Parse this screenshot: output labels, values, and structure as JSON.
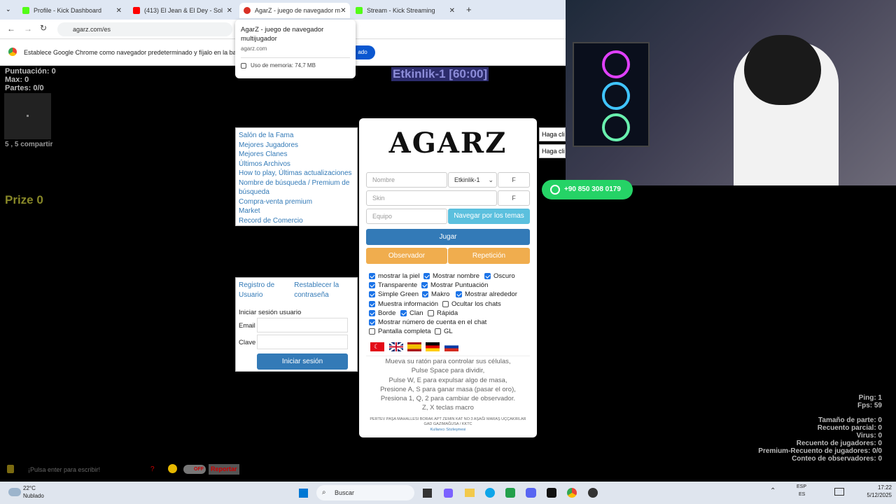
{
  "tabs": [
    {
      "label": "Profile - Kick Dashboard",
      "icon": "kick-icon",
      "color": "#53fc18"
    },
    {
      "label": "(413) El Jean & El Dey - Sol",
      "icon": "youtube-icon",
      "color": "#ff0000"
    },
    {
      "label": "AgarZ - juego de navegador m",
      "icon": "agarz-icon",
      "color": "#d93025"
    },
    {
      "label": "Stream - Kick Streaming",
      "icon": "kick-icon",
      "color": "#53fc18"
    }
  ],
  "address": "agarz.com/es",
  "infobar_text": "Establece Google Chrome como navegador predeterminado y fíjalo en la barra",
  "infobar_button": "ado",
  "tooltip": {
    "title": "AgarZ - juego de navegador multijugador",
    "domain": "agarz.com",
    "memory": "Uso de memoria: 74,7 MB"
  },
  "hud": {
    "score": "Puntuación: 0",
    "max": "Max: 0",
    "parts": "Partes: 0/0",
    "share": "5 , 5 compartir",
    "prize": "Prize 0",
    "event": "Etkinlik-1 [60:00]"
  },
  "menu": [
    "Salón de la Fama",
    "Mejores Jugadores",
    "Mejores Clanes",
    "Últimos Archivos",
    "How to play, Últimas actualizaciones",
    "Nombre de búsqueda /  Premium de búsqueda",
    "Compra-venta premium",
    "Market",
    "Record de Comercio"
  ],
  "login": {
    "register": "Registro de Usuario",
    "reset": "Restablecer la contraseña",
    "title": "Iniciar sesión usuario",
    "email_label": "Email",
    "password_label": "Clave",
    "submit": "Iniciar sesión"
  },
  "modal": {
    "logo": "AGARZ",
    "name_placeholder": "Nombre",
    "server": "Etkinlik-1",
    "f1": "F",
    "skin_placeholder": "Skin",
    "f2": "F",
    "team_placeholder": "Equipo",
    "browse": "Navegar por los temas",
    "play": "Jugar",
    "observer": "Observador",
    "replay": "Repetición",
    "options": [
      {
        "label": "mostrar la piel",
        "on": true
      },
      {
        "label": "Mostrar nombre",
        "on": true
      },
      {
        "label": "Oscuro",
        "on": true
      },
      {
        "label": "Transparente",
        "on": true
      },
      {
        "label": "Mostrar Puntuación",
        "on": true
      },
      {
        "label": "Simple Green",
        "on": true
      },
      {
        "label": "Makro",
        "on": true
      },
      {
        "label": "Mostrar alrededor",
        "on": true
      },
      {
        "label": "Muestra información",
        "on": true
      },
      {
        "label": "Ocultar los chats",
        "on": false
      },
      {
        "label": "Borde",
        "on": true
      },
      {
        "label": "Clan",
        "on": true
      },
      {
        "label": "Rápida",
        "on": false
      },
      {
        "label": "Mostrar número de cuenta en el chat",
        "on": true
      },
      {
        "label": "Pantalla completa",
        "on": false
      },
      {
        "label": "GL",
        "on": false
      }
    ],
    "instructions": [
      "Mueva su ratón para controlar sus células,",
      "Pulse Space para dividir,",
      "Pulse W, E para expulsar algo de masa,",
      "Presione A, S para ganar masa (pasar el oro),",
      "Presiona 1, Q, 2 para cambiar de observador.",
      "Z, X teclas macro"
    ],
    "footer": "PERTEV PAŞA MAHALLESI BORAK APT ZEMIN KAT NO:3 AŞAĞI MARAŞ UÇÇAKIRLAR GAD GAZIMAĞUSA / KKTC",
    "footer_link": "Kullanıcı Sözleşmesi"
  },
  "side_buttons": [
    "Haga cli",
    "Haga cli"
  ],
  "whatsapp": "+90 850 308 0179",
  "stats_top": [
    "Ping: 1",
    "Fps: 59"
  ],
  "stats_bottom": [
    "Tamaño de parte: 0",
    "Recuento parcial: 0",
    "Virus: 0",
    "Recuento de jugadores: 0",
    "Premium-Recuento de jugadores: 0/0",
    "Conteo de observadores: 0"
  ],
  "chat": {
    "placeholder": "¡Pulsa enter para escribir!",
    "toggle": "OFF",
    "report": "Reportar"
  },
  "taskbar": {
    "temp": "22°C",
    "weather": "Nublado",
    "search": "Buscar",
    "lang1": "ESP",
    "lang2": "ES",
    "time": "17:22",
    "date": "5/12/2025"
  }
}
